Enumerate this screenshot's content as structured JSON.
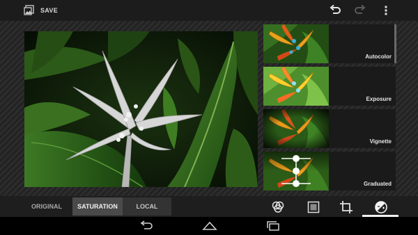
{
  "actionbar": {
    "save_label": "SAVE",
    "icons": [
      "gallery-icon",
      "undo-icon",
      "redo-icon",
      "overflow-menu-icon"
    ],
    "redo_enabled": false
  },
  "filters": [
    {
      "label": "Autocolor",
      "selected": true
    },
    {
      "label": "Exposure",
      "selected": false
    },
    {
      "label": "Vignette",
      "selected": false
    },
    {
      "label": "Graduated",
      "selected": false
    }
  ],
  "tabs": {
    "original": "ORIGINAL",
    "saturation": "SATURATION",
    "local": "LOCAL",
    "active": "SATURATION"
  },
  "categories": {
    "icons": [
      "effects-icon",
      "border-icon",
      "crop-icon",
      "adjust-icon"
    ],
    "active": "adjust-icon"
  },
  "colors": {
    "actionbar": "#1c1c1c",
    "bottompanel": "#1e1e1e",
    "active_tab": "#4a4a4a",
    "underline": "#f2f2f2"
  }
}
